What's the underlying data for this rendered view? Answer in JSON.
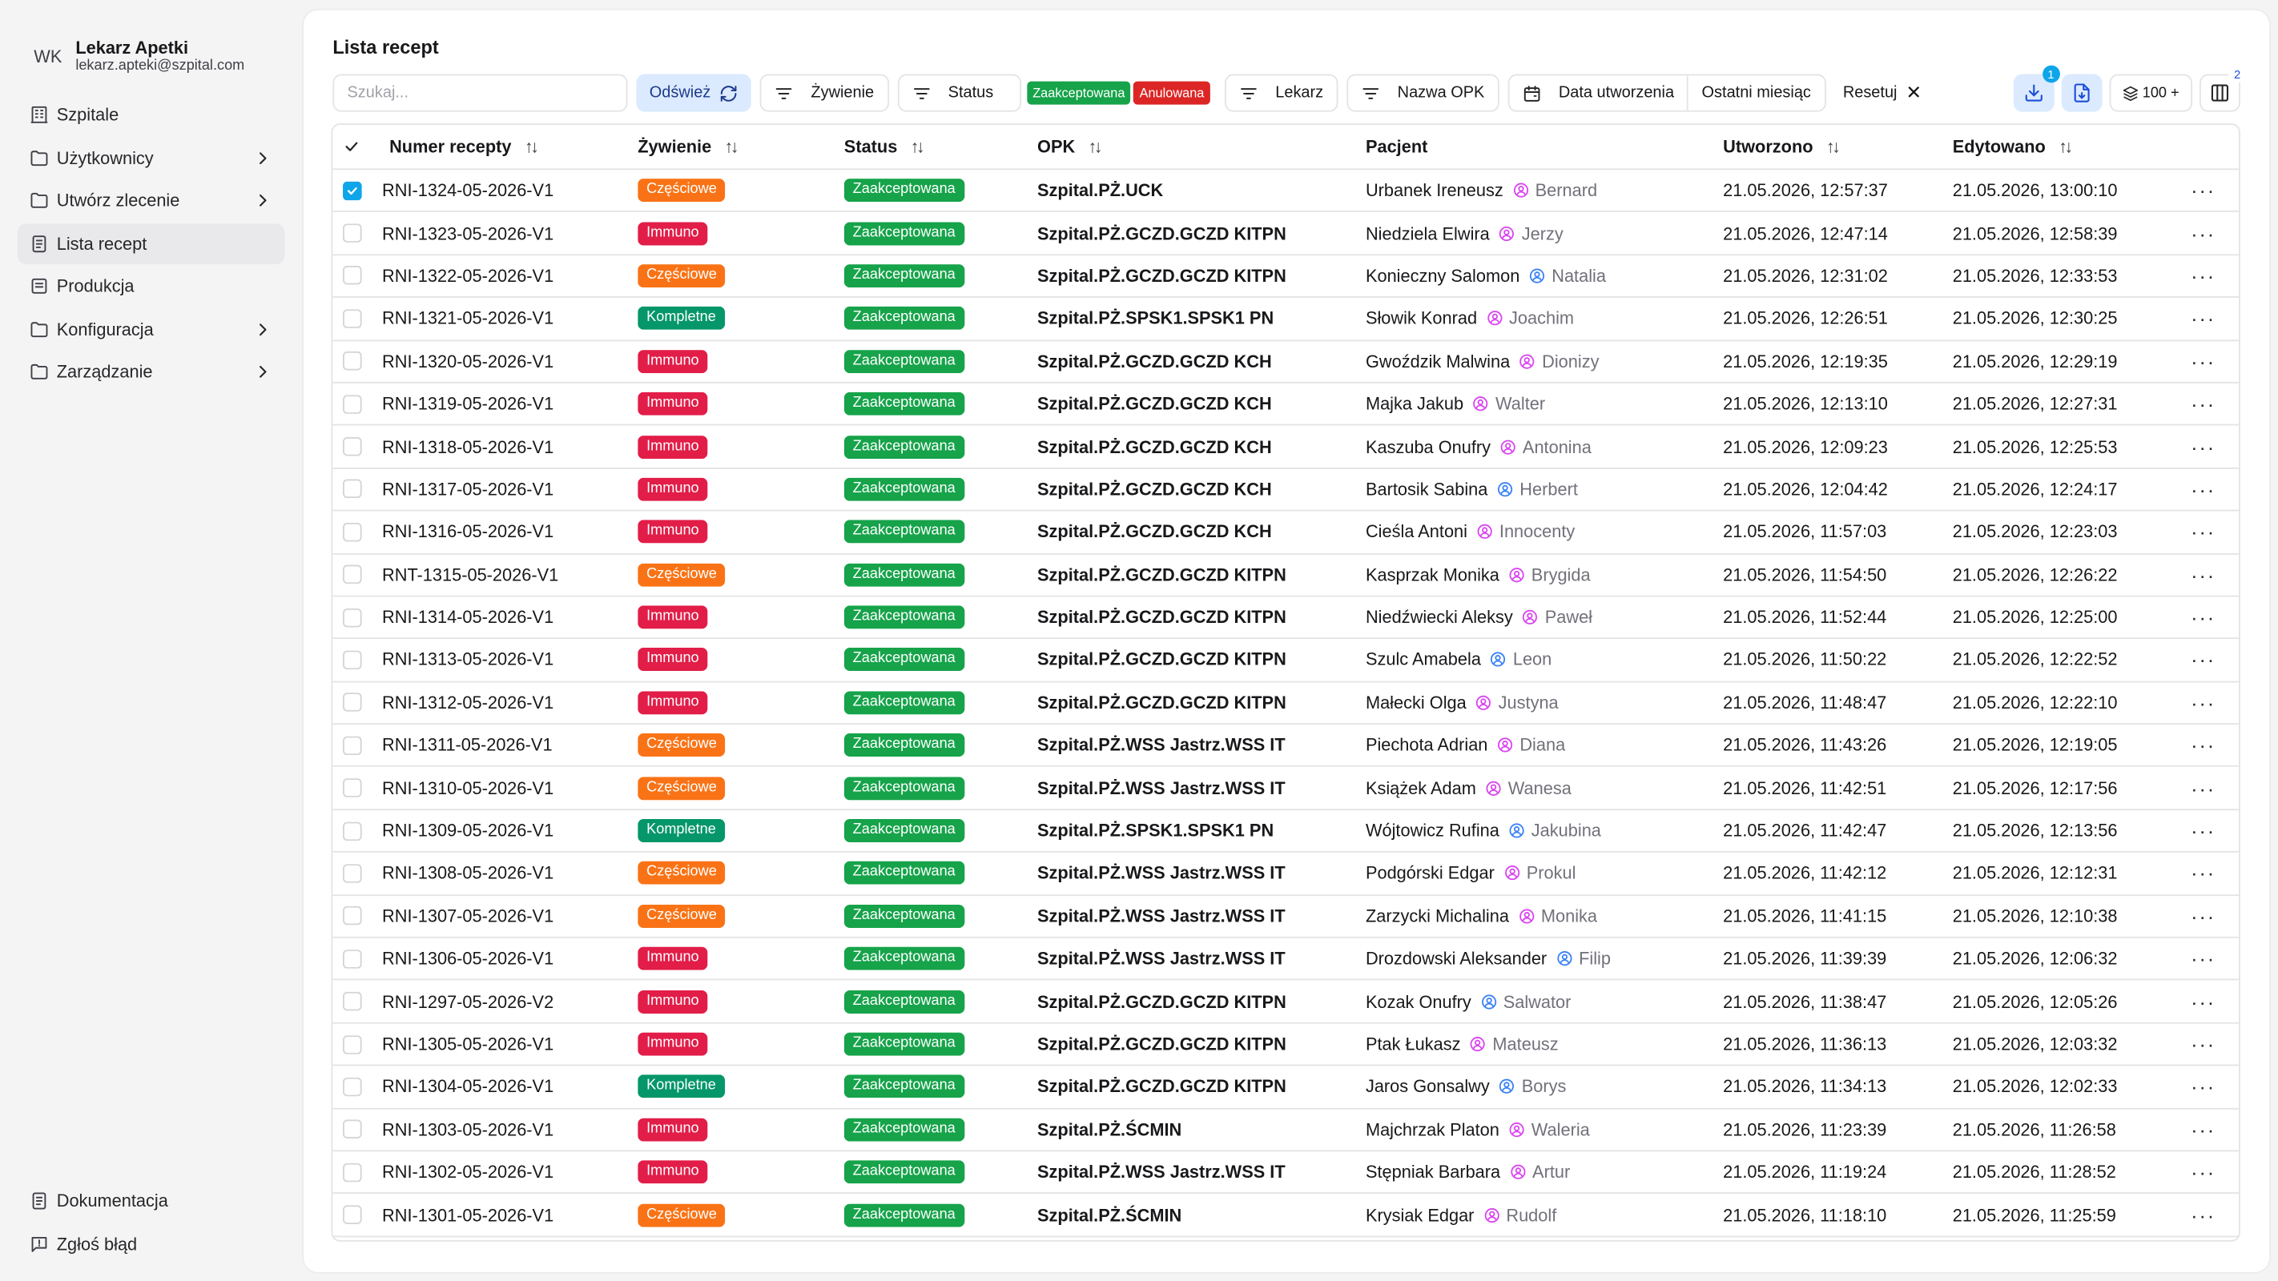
{
  "user": {
    "initials": "WK",
    "name": "Lekarz Apetki",
    "email": "lekarz.apteki@szpital.com"
  },
  "sidebar": {
    "items": [
      {
        "label": "Szpitale",
        "icon": "building-icon",
        "submenu": false,
        "active": false
      },
      {
        "label": "Użytkownicy",
        "icon": "users-icon",
        "submenu": true,
        "active": false
      },
      {
        "label": "Utwórz zlecenie",
        "icon": "create-order-icon",
        "submenu": true,
        "active": false
      },
      {
        "label": "Lista recept",
        "icon": "list-icon",
        "submenu": false,
        "active": true
      },
      {
        "label": "Produkcja",
        "icon": "production-icon",
        "submenu": false,
        "active": false
      },
      {
        "label": "Konfiguracja",
        "icon": "config-icon",
        "submenu": true,
        "active": false
      },
      {
        "label": "Zarządzanie",
        "icon": "manage-icon",
        "submenu": true,
        "active": false
      }
    ],
    "bottom": [
      {
        "label": "Dokumentacja",
        "icon": "docs-icon"
      },
      {
        "label": "Zgłoś błąd",
        "icon": "report-bug-icon"
      }
    ]
  },
  "page": {
    "title": "Lista recept"
  },
  "toolbar": {
    "search_placeholder": "Szukaj...",
    "refresh_label": "Odśwież",
    "diet_filter_label": "Żywienie",
    "status_filter_label": "Status",
    "status_chips": [
      {
        "label": "Zaakceptowana",
        "color": "#16a34a"
      },
      {
        "label": "Anulowana",
        "color": "#dc2626"
      }
    ],
    "doctor_filter_label": "Lekarz",
    "opk_filter_label": "Nazwa OPK",
    "date_filter_label": "Data utworzenia",
    "date_filter_value": "Ostatni miesiąc",
    "reset_label": "Resetuj",
    "download_badge": "1",
    "rows_per_page": "100 +",
    "columns_badge": "2"
  },
  "table": {
    "columns": {
      "number": "Numer recepty",
      "diet": "Żywienie",
      "status": "Status",
      "opk": "OPK",
      "patient": "Pacjent",
      "created": "Utworzono",
      "edited": "Edytowano"
    },
    "diet_colors": {
      "Częściowe": "#f97316",
      "Immuno": "#e11d48",
      "Kompletne": "#059669"
    },
    "doctor_icon_colors": {
      "female": "#d946ef",
      "male": "#3b82f6"
    },
    "status_color": "#16a34a",
    "rows": [
      {
        "number": "RNI-1324-05-2026-V1",
        "diet": "Częściowe",
        "status": "Zaakceptowana",
        "opk": "Szpital.PŻ.UCK",
        "patient": "Urbanek Ireneusz",
        "doctor": "Bernard",
        "doctor_gender": "female",
        "created": "21.05.2026, 12:57:37",
        "edited": "21.05.2026, 13:00:10",
        "checked": true
      },
      {
        "number": "RNI-1323-05-2026-V1",
        "diet": "Immuno",
        "status": "Zaakceptowana",
        "opk": "Szpital.PŻ.GCZD.GCZD KITPN",
        "patient": "Niedziela Elwira",
        "doctor": "Jerzy",
        "doctor_gender": "female",
        "created": "21.05.2026, 12:47:14",
        "edited": "21.05.2026, 12:58:39",
        "checked": false
      },
      {
        "number": "RNI-1322-05-2026-V1",
        "diet": "Częściowe",
        "status": "Zaakceptowana",
        "opk": "Szpital.PŻ.GCZD.GCZD KITPN",
        "patient": "Konieczny Salomon",
        "doctor": "Natalia",
        "doctor_gender": "male",
        "created": "21.05.2026, 12:31:02",
        "edited": "21.05.2026, 12:33:53",
        "checked": false
      },
      {
        "number": "RNI-1321-05-2026-V1",
        "diet": "Kompletne",
        "status": "Zaakceptowana",
        "opk": "Szpital.PŻ.SPSK1.SPSK1 PN",
        "patient": "Słowik Konrad",
        "doctor": "Joachim",
        "doctor_gender": "female",
        "created": "21.05.2026, 12:26:51",
        "edited": "21.05.2026, 12:30:25",
        "checked": false
      },
      {
        "number": "RNI-1320-05-2026-V1",
        "diet": "Immuno",
        "status": "Zaakceptowana",
        "opk": "Szpital.PŻ.GCZD.GCZD KCH",
        "patient": "Gwoździk Malwina",
        "doctor": "Dionizy",
        "doctor_gender": "female",
        "created": "21.05.2026, 12:19:35",
        "edited": "21.05.2026, 12:29:19",
        "checked": false
      },
      {
        "number": "RNI-1319-05-2026-V1",
        "diet": "Immuno",
        "status": "Zaakceptowana",
        "opk": "Szpital.PŻ.GCZD.GCZD KCH",
        "patient": "Majka Jakub",
        "doctor": "Walter",
        "doctor_gender": "female",
        "created": "21.05.2026, 12:13:10",
        "edited": "21.05.2026, 12:27:31",
        "checked": false
      },
      {
        "number": "RNI-1318-05-2026-V1",
        "diet": "Immuno",
        "status": "Zaakceptowana",
        "opk": "Szpital.PŻ.GCZD.GCZD KCH",
        "patient": "Kaszuba Onufry",
        "doctor": "Antonina",
        "doctor_gender": "female",
        "created": "21.05.2026, 12:09:23",
        "edited": "21.05.2026, 12:25:53",
        "checked": false
      },
      {
        "number": "RNI-1317-05-2026-V1",
        "diet": "Immuno",
        "status": "Zaakceptowana",
        "opk": "Szpital.PŻ.GCZD.GCZD KCH",
        "patient": "Bartosik Sabina",
        "doctor": "Herbert",
        "doctor_gender": "male",
        "created": "21.05.2026, 12:04:42",
        "edited": "21.05.2026, 12:24:17",
        "checked": false
      },
      {
        "number": "RNI-1316-05-2026-V1",
        "diet": "Immuno",
        "status": "Zaakceptowana",
        "opk": "Szpital.PŻ.GCZD.GCZD KCH",
        "patient": "Cieśla Antoni",
        "doctor": "Innocenty",
        "doctor_gender": "female",
        "created": "21.05.2026, 11:57:03",
        "edited": "21.05.2026, 12:23:03",
        "checked": false
      },
      {
        "number": "RNT-1315-05-2026-V1",
        "diet": "Częściowe",
        "status": "Zaakceptowana",
        "opk": "Szpital.PŻ.GCZD.GCZD KITPN",
        "patient": "Kasprzak Monika",
        "doctor": "Brygida",
        "doctor_gender": "female",
        "created": "21.05.2026, 11:54:50",
        "edited": "21.05.2026, 12:26:22",
        "checked": false
      },
      {
        "number": "RNI-1314-05-2026-V1",
        "diet": "Immuno",
        "status": "Zaakceptowana",
        "opk": "Szpital.PŻ.GCZD.GCZD KITPN",
        "patient": "Niedźwiecki Aleksy",
        "doctor": "Paweł",
        "doctor_gender": "female",
        "created": "21.05.2026, 11:52:44",
        "edited": "21.05.2026, 12:25:00",
        "checked": false
      },
      {
        "number": "RNI-1313-05-2026-V1",
        "diet": "Immuno",
        "status": "Zaakceptowana",
        "opk": "Szpital.PŻ.GCZD.GCZD KITPN",
        "patient": "Szulc Amabela",
        "doctor": "Leon",
        "doctor_gender": "male",
        "created": "21.05.2026, 11:50:22",
        "edited": "21.05.2026, 12:22:52",
        "checked": false
      },
      {
        "number": "RNI-1312-05-2026-V1",
        "diet": "Immuno",
        "status": "Zaakceptowana",
        "opk": "Szpital.PŻ.GCZD.GCZD KITPN",
        "patient": "Małecki Olga",
        "doctor": "Justyna",
        "doctor_gender": "female",
        "created": "21.05.2026, 11:48:47",
        "edited": "21.05.2026, 12:22:10",
        "checked": false
      },
      {
        "number": "RNI-1311-05-2026-V1",
        "diet": "Częściowe",
        "status": "Zaakceptowana",
        "opk": "Szpital.PŻ.WSS Jastrz.WSS IT",
        "patient": "Piechota Adrian",
        "doctor": "Diana",
        "doctor_gender": "female",
        "created": "21.05.2026, 11:43:26",
        "edited": "21.05.2026, 12:19:05",
        "checked": false
      },
      {
        "number": "RNI-1310-05-2026-V1",
        "diet": "Częściowe",
        "status": "Zaakceptowana",
        "opk": "Szpital.PŻ.WSS Jastrz.WSS IT",
        "patient": "Książek Adam",
        "doctor": "Wanesa",
        "doctor_gender": "female",
        "created": "21.05.2026, 11:42:51",
        "edited": "21.05.2026, 12:17:56",
        "checked": false
      },
      {
        "number": "RNI-1309-05-2026-V1",
        "diet": "Kompletne",
        "status": "Zaakceptowana",
        "opk": "Szpital.PŻ.SPSK1.SPSK1 PN",
        "patient": "Wójtowicz Rufina",
        "doctor": "Jakubina",
        "doctor_gender": "male",
        "created": "21.05.2026, 11:42:47",
        "edited": "21.05.2026, 12:13:56",
        "checked": false
      },
      {
        "number": "RNI-1308-05-2026-V1",
        "diet": "Częściowe",
        "status": "Zaakceptowana",
        "opk": "Szpital.PŻ.WSS Jastrz.WSS IT",
        "patient": "Podgórski Edgar",
        "doctor": "Prokul",
        "doctor_gender": "female",
        "created": "21.05.2026, 11:42:12",
        "edited": "21.05.2026, 12:12:31",
        "checked": false
      },
      {
        "number": "RNI-1307-05-2026-V1",
        "diet": "Częściowe",
        "status": "Zaakceptowana",
        "opk": "Szpital.PŻ.WSS Jastrz.WSS IT",
        "patient": "Zarzycki Michalina",
        "doctor": "Monika",
        "doctor_gender": "female",
        "created": "21.05.2026, 11:41:15",
        "edited": "21.05.2026, 12:10:38",
        "checked": false
      },
      {
        "number": "RNI-1306-05-2026-V1",
        "diet": "Immuno",
        "status": "Zaakceptowana",
        "opk": "Szpital.PŻ.WSS Jastrz.WSS IT",
        "patient": "Drozdowski Aleksander",
        "doctor": "Filip",
        "doctor_gender": "male",
        "created": "21.05.2026, 11:39:39",
        "edited": "21.05.2026, 12:06:32",
        "checked": false
      },
      {
        "number": "RNI-1297-05-2026-V2",
        "diet": "Immuno",
        "status": "Zaakceptowana",
        "opk": "Szpital.PŻ.GCZD.GCZD KITPN",
        "patient": "Kozak Onufry",
        "doctor": "Salwator",
        "doctor_gender": "male",
        "created": "21.05.2026, 11:38:47",
        "edited": "21.05.2026, 12:05:26",
        "checked": false
      },
      {
        "number": "RNI-1305-05-2026-V1",
        "diet": "Immuno",
        "status": "Zaakceptowana",
        "opk": "Szpital.PŻ.GCZD.GCZD KITPN",
        "patient": "Ptak Łukasz",
        "doctor": "Mateusz",
        "doctor_gender": "female",
        "created": "21.05.2026, 11:36:13",
        "edited": "21.05.2026, 12:03:32",
        "checked": false
      },
      {
        "number": "RNI-1304-05-2026-V1",
        "diet": "Kompletne",
        "status": "Zaakceptowana",
        "opk": "Szpital.PŻ.GCZD.GCZD KITPN",
        "patient": "Jaros Gonsalwy",
        "doctor": "Borys",
        "doctor_gender": "male",
        "created": "21.05.2026, 11:34:13",
        "edited": "21.05.2026, 12:02:33",
        "checked": false
      },
      {
        "number": "RNI-1303-05-2026-V1",
        "diet": "Immuno",
        "status": "Zaakceptowana",
        "opk": "Szpital.PŻ.ŚCMIN",
        "patient": "Majchrzak Platon",
        "doctor": "Waleria",
        "doctor_gender": "female",
        "created": "21.05.2026, 11:23:39",
        "edited": "21.05.2026, 11:26:58",
        "checked": false
      },
      {
        "number": "RNI-1302-05-2026-V1",
        "diet": "Immuno",
        "status": "Zaakceptowana",
        "opk": "Szpital.PŻ.WSS Jastrz.WSS IT",
        "patient": "Stępniak Barbara",
        "doctor": "Artur",
        "doctor_gender": "female",
        "created": "21.05.2026, 11:19:24",
        "edited": "21.05.2026, 11:28:52",
        "checked": false
      },
      {
        "number": "RNI-1301-05-2026-V1",
        "diet": "Częściowe",
        "status": "Zaakceptowana",
        "opk": "Szpital.PŻ.ŚCMIN",
        "patient": "Krysiak Edgar",
        "doctor": "Rudolf",
        "doctor_gender": "female",
        "created": "21.05.2026, 11:18:10",
        "edited": "21.05.2026, 11:25:59",
        "checked": false
      }
    ]
  }
}
